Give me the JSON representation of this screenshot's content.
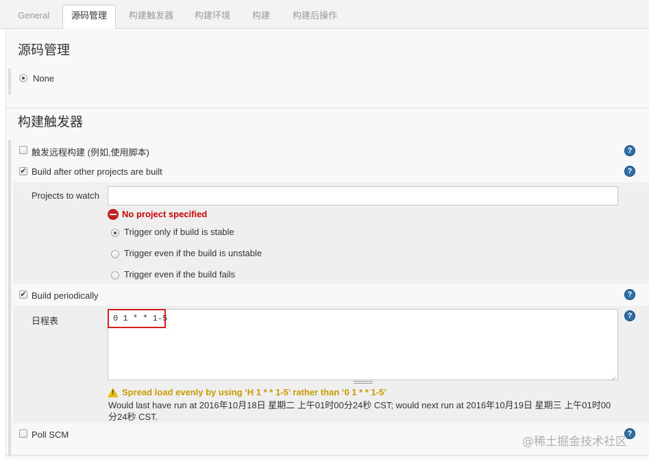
{
  "tabs": [
    "General",
    "源码管理",
    "构建触发器",
    "构建环境",
    "构建",
    "构建后操作"
  ],
  "scm": {
    "title": "源码管理",
    "none_label": "None"
  },
  "triggers": {
    "title": "构建触发器",
    "remote_label": "触发远程构建 (例如,使用脚本)",
    "remote_checked": false,
    "after_other_label": "Build after other projects are built",
    "after_other_checked": true,
    "projects_to_watch_label": "Projects to watch",
    "projects_to_watch_value": "",
    "error_text": "No project specified",
    "trigger_options": [
      "Trigger only if build is stable",
      "Trigger even if the build is unstable",
      "Trigger even if the build fails"
    ],
    "trigger_selected": 0,
    "periodic_label": "Build periodically",
    "periodic_checked": true,
    "schedule_label": "日程表",
    "schedule_value": "0 1 * *  1-5",
    "warning_text": "Spread load evenly by using ‘H 1 * *  1-5’ rather than ‘0 1 * *  1-5’",
    "info_text": "Would last have run at 2016年10月18日 星期二 上午01时00分24秒 CST; would next run at 2016年10月19日 星期三 上午01时00分24秒 CST.",
    "poll_label": "Poll SCM",
    "poll_checked": false
  },
  "help_icon_glyph": "?",
  "watermark": "@稀土掘金技术社区",
  "colors": {
    "error": "#cc0000",
    "warning": "#c99a00",
    "highlight": "#d31d1d",
    "help": "#2c6ea5"
  }
}
